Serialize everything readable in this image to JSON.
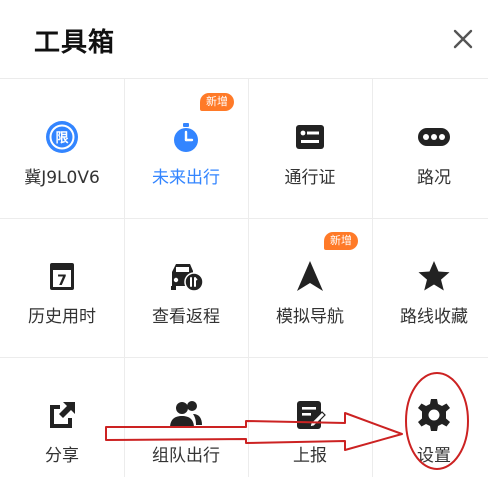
{
  "header": {
    "title": "工具箱",
    "close_icon": "close-icon"
  },
  "tools": [
    {
      "label": "冀J9L0V6",
      "icon": "restriction-icon",
      "color": "#3385ff"
    },
    {
      "label": "未来出行",
      "icon": "stopwatch-icon",
      "badge": "新增",
      "highlight": true,
      "color": "#3385ff"
    },
    {
      "label": "通行证",
      "icon": "pass-card-icon",
      "color": "#222222"
    },
    {
      "label": "路况",
      "icon": "traffic-icon",
      "color": "#222222"
    },
    {
      "label": "历史用时",
      "icon": "calendar-icon",
      "color": "#222222"
    },
    {
      "label": "查看返程",
      "icon": "return-trip-icon",
      "color": "#222222"
    },
    {
      "label": "模拟导航",
      "icon": "navigation-arrow-icon",
      "badge": "新增",
      "color": "#222222"
    },
    {
      "label": "路线收藏",
      "icon": "star-icon",
      "color": "#222222"
    },
    {
      "label": "分享",
      "icon": "share-icon",
      "color": "#222222"
    },
    {
      "label": "组队出行",
      "icon": "team-icon",
      "color": "#222222"
    },
    {
      "label": "上报",
      "icon": "report-icon",
      "color": "#222222"
    },
    {
      "label": "设置",
      "icon": "gear-icon",
      "color": "#222222"
    }
  ],
  "colors": {
    "accent": "#3385ff",
    "badge": "#ff7a28",
    "annotation": "#cc2222"
  },
  "annotation": {
    "arrow_icon": "arrow-annotation",
    "circle_icon": "circle-annotation"
  }
}
